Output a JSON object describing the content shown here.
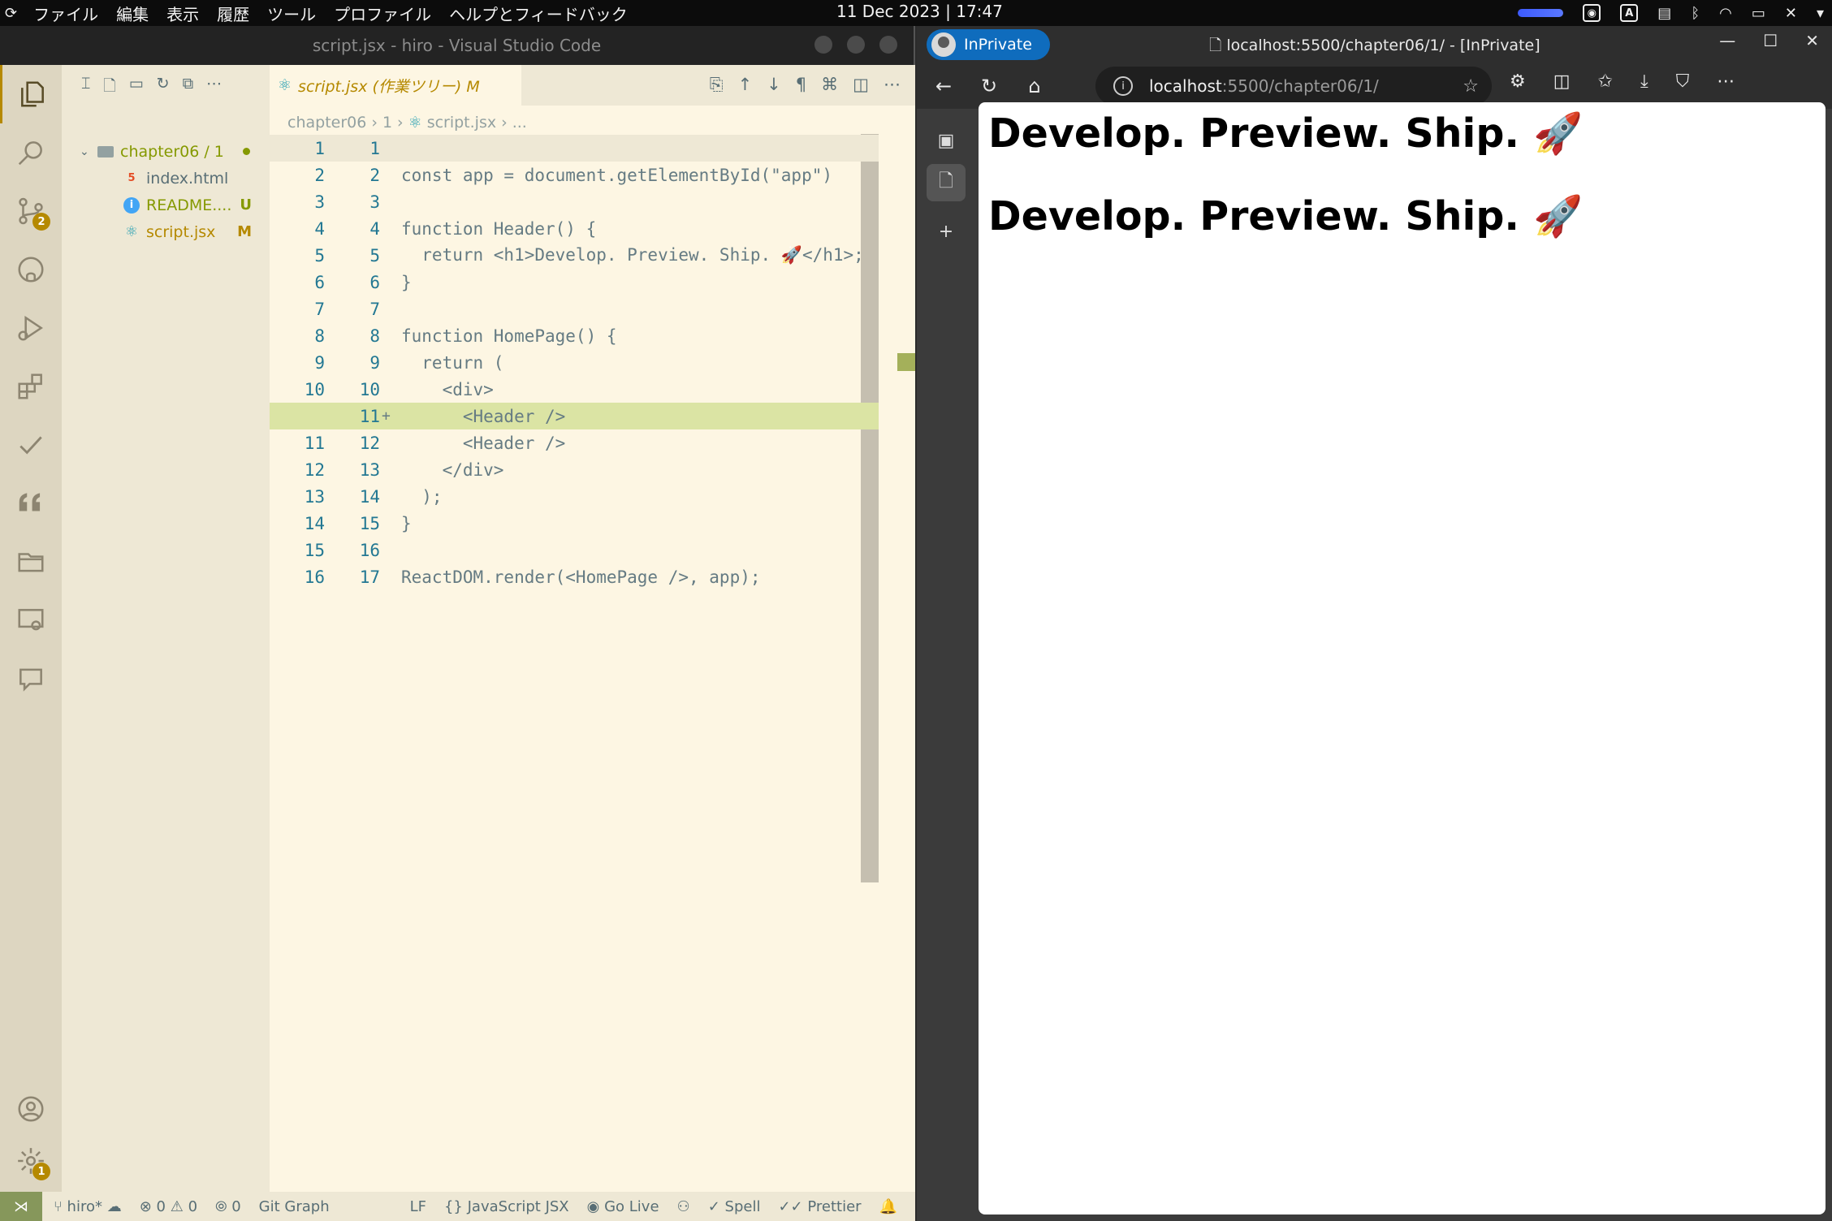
{
  "system_bar": {
    "menu": [
      "ファイル",
      "編集",
      "表示",
      "履歴",
      "ツール",
      "プロファイル",
      "ヘルプとフィードバック"
    ],
    "clock": "11 Dec 2023 | 17:47"
  },
  "vscode": {
    "window_title": "script.jsx - hiro - Visual Studio Code",
    "activity_badges": {
      "source_control": "2",
      "settings": "1"
    },
    "explorer": {
      "folder": "chapter06 / 1",
      "files": [
        {
          "name": "index.html",
          "badge": ""
        },
        {
          "name": "README....",
          "badge": "U"
        },
        {
          "name": "script.jsx",
          "badge": "M"
        }
      ]
    },
    "tab": {
      "label": "script.jsx (作業ツリー) M"
    },
    "breadcrumb": {
      "folder": "chapter06",
      "sub": "1",
      "file": "script.jsx",
      "more": "..."
    },
    "code": {
      "lines": [
        {
          "old": "1",
          "new": "1",
          "text": ""
        },
        {
          "old": "2",
          "new": "2",
          "text": "const app = document.getElementById(\"app\")"
        },
        {
          "old": "3",
          "new": "3",
          "text": ""
        },
        {
          "old": "4",
          "new": "4",
          "text": "function Header() {"
        },
        {
          "old": "5",
          "new": "5",
          "text": "  return <h1>Develop. Preview. Ship. 🚀</h1>;"
        },
        {
          "old": "6",
          "new": "6",
          "text": "}"
        },
        {
          "old": "7",
          "new": "7",
          "text": ""
        },
        {
          "old": "8",
          "new": "8",
          "text": "function HomePage() {"
        },
        {
          "old": "9",
          "new": "9",
          "text": "  return ("
        },
        {
          "old": "10",
          "new": "10",
          "text": "    <div>"
        },
        {
          "old": "",
          "new": "11",
          "text": "      <Header />"
        },
        {
          "old": "11",
          "new": "12",
          "text": "      <Header />"
        },
        {
          "old": "12",
          "new": "13",
          "text": "    </div>"
        },
        {
          "old": "13",
          "new": "14",
          "text": "  );"
        },
        {
          "old": "14",
          "new": "15",
          "text": "}"
        },
        {
          "old": "15",
          "new": "16",
          "text": ""
        },
        {
          "old": "16",
          "new": "17",
          "text": "ReactDOM.render(<HomePage />, app);"
        }
      ],
      "added_marker": "+"
    },
    "status": {
      "branch": "hiro*",
      "errors": "0",
      "warnings": "0",
      "ports": "0",
      "git_graph": "Git Graph",
      "eol": "LF",
      "language": "JavaScript JSX",
      "go_live": "Go Live",
      "spell": "Spell",
      "prettier": "Prettier"
    }
  },
  "browser": {
    "inprivate_label": "InPrivate",
    "title": "localhost:5500/chapter06/1/ - [InPrivate]",
    "url_host": "localhost",
    "url_path": ":5500/chapter06/1/",
    "page": {
      "headings": [
        "Develop. Preview. Ship. 🚀",
        "Develop. Preview. Ship. 🚀"
      ]
    }
  },
  "colors": {
    "editor_bg": "#fdf6e3",
    "sidebar_bg": "#eee8d5",
    "activity_bg": "#ddd6c1",
    "added_line": "#dbe4a4",
    "inprivate": "#0f6cbd"
  }
}
